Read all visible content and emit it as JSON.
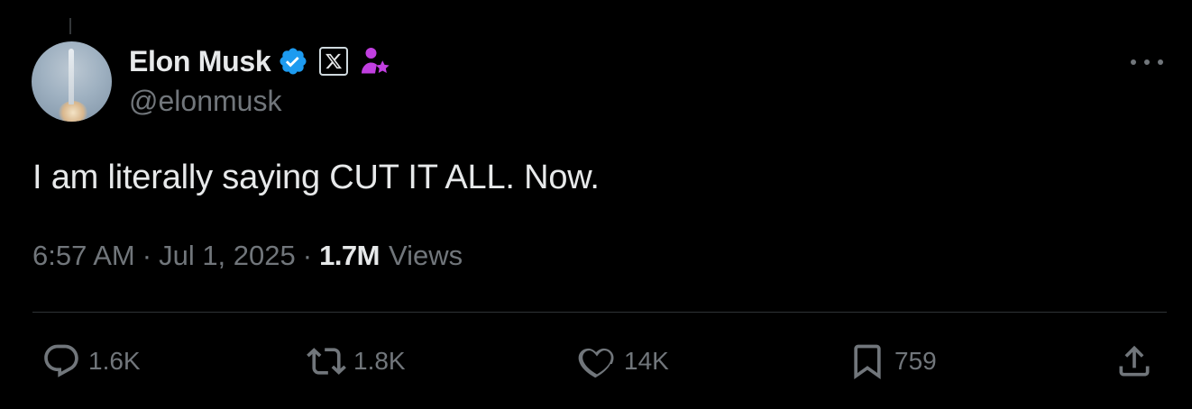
{
  "author": {
    "name": "Elon Musk",
    "handle": "@elonmusk",
    "verified_icon": "verified-badge-icon",
    "affiliate_icon": "x-logo-icon",
    "badge_icon": "person-star-icon"
  },
  "tweet": {
    "text": "I am literally saying CUT IT ALL. Now.",
    "time": "6:57 AM",
    "date": "Jul 1, 2025",
    "separator": "·",
    "views_count": "1.7M",
    "views_label": "Views"
  },
  "actions": {
    "replies": "1.6K",
    "reposts": "1.8K",
    "likes": "14K",
    "bookmarks": "759"
  },
  "colors": {
    "background": "#000000",
    "text": "#e7e9ea",
    "secondary": "#71767b",
    "verified": "#1d9bf0",
    "badge": "#c13fe0"
  }
}
